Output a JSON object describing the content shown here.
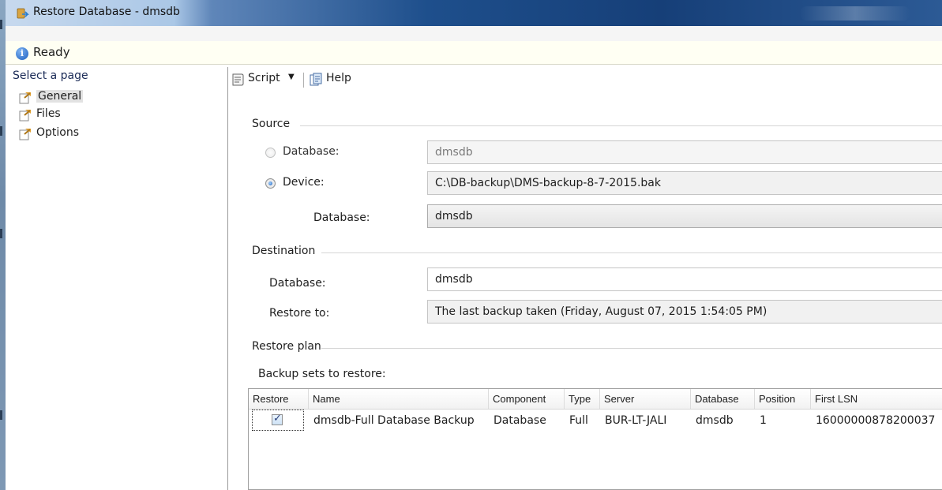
{
  "window": {
    "title": "Restore Database - dmsdb"
  },
  "status": {
    "text": "Ready",
    "icon": "info-icon"
  },
  "left_pane": {
    "heading": "Select a page",
    "pages": [
      {
        "label": "General",
        "icon": "page-wrench-icon",
        "selected": true
      },
      {
        "label": "Files",
        "icon": "page-wrench-icon",
        "selected": false
      },
      {
        "label": "Options",
        "icon": "page-wrench-icon",
        "selected": false
      }
    ]
  },
  "toolbar": {
    "script_label": "Script",
    "help_label": "Help"
  },
  "source": {
    "header": "Source",
    "database_radio_label": "Database:",
    "database_value": "dmsdb",
    "device_radio_label": "Device:",
    "device_value": "C:\\DB-backup\\DMS-backup-8-7-2015.bak",
    "selected_option": "Device",
    "device_database_label": "Database:",
    "device_database_value": "dmsdb"
  },
  "destination": {
    "header": "Destination",
    "database_label": "Database:",
    "database_value": "dmsdb",
    "restore_to_label": "Restore to:",
    "restore_to_value": "The last backup taken (Friday, August 07, 2015 1:54:05 PM)"
  },
  "restore_plan": {
    "header": "Restore plan",
    "backup_sets_label": "Backup sets to restore:",
    "columns": [
      "Restore",
      "Name",
      "Component",
      "Type",
      "Server",
      "Database",
      "Position",
      "First LSN"
    ],
    "rows": [
      {
        "restore": true,
        "name": "dmsdb-Full Database Backup",
        "component": "Database",
        "type": "Full",
        "server": "BUR-LT-JALI",
        "database": "dmsdb",
        "position": "1",
        "first_lsn": "16000000878200037"
      }
    ]
  },
  "colors": {
    "title_bar": "#1e4f8c",
    "status_bar": "#fffff3",
    "heading_text": "#1a2a56"
  }
}
